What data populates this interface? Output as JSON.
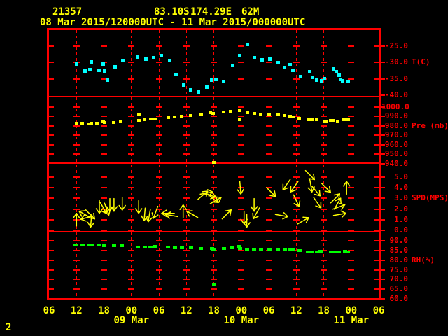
{
  "header": {
    "station_id": "21357",
    "latitude": "83.10S",
    "longitude": "174.29E",
    "elevation": "62M",
    "period": "08 Mar 2015/120000UTC - 11 Mar 2015/000000UTC"
  },
  "page_number": "2",
  "colors": {
    "background": "#000000",
    "frame": "#ff0000",
    "axis_labels": "#ff0000",
    "time_labels": "#ffff00",
    "temperature": "#00ffff",
    "pressure": "#ffff00",
    "wind": "#ffff00",
    "relative_humidity": "#00ff00"
  },
  "x_axis": {
    "start": "08 Mar 2015 06UTC",
    "end": "11 Mar 2015 06UTC",
    "hours_span": 72,
    "hour_tick_interval": 6,
    "hour_labels": [
      "06",
      "12",
      "18",
      "00",
      "06",
      "12",
      "18",
      "00",
      "06",
      "12",
      "18",
      "00",
      "06"
    ],
    "date_labels": [
      {
        "label": "09 Mar",
        "hour": 18
      },
      {
        "label": "10 Mar",
        "hour": 42
      },
      {
        "label": "11 Mar",
        "hour": 66
      }
    ]
  },
  "chart_data": [
    {
      "name": "temperature",
      "type": "scatter",
      "unit_label": "T(C)",
      "unit_label_value": -30,
      "color": "#00ffff",
      "ylim": [
        -40.43,
        -19.86
      ],
      "tick_values": [
        -25,
        -30,
        -35,
        -40
      ],
      "tick_labels": [
        "-25.0",
        "-30.0",
        "-35.0",
        "-40.0"
      ],
      "plus_rows": [
        -25,
        -30,
        -35
      ],
      "points": [
        [
          6.0,
          -30.4
        ],
        [
          7.8,
          -32.7
        ],
        [
          8.9,
          -32.1
        ],
        [
          9.3,
          -29.9
        ],
        [
          10.9,
          -32.5
        ],
        [
          11.8,
          -30.4
        ],
        [
          12.2,
          -32.7
        ],
        [
          12.7,
          -35.5
        ],
        [
          14.4,
          -31.4
        ],
        [
          16.1,
          -29.5
        ],
        [
          19.4,
          -28.4
        ],
        [
          21.1,
          -28.9
        ],
        [
          22.9,
          -28.6
        ],
        [
          24.6,
          -27.8
        ],
        [
          26.3,
          -29.3
        ],
        [
          27.7,
          -33.6
        ],
        [
          29.5,
          -37.0
        ],
        [
          31.0,
          -38.3
        ],
        [
          32.7,
          -39.1
        ],
        [
          34.5,
          -37.6
        ],
        [
          35.6,
          -35.5
        ],
        [
          36.4,
          -35.1
        ],
        [
          38.2,
          -35.9
        ],
        [
          40.1,
          -30.8
        ],
        [
          41.6,
          -27.8
        ],
        [
          43.3,
          -24.4
        ],
        [
          44.9,
          -28.6
        ],
        [
          46.5,
          -29.1
        ],
        [
          48.3,
          -28.9
        ],
        [
          50.0,
          -30.1
        ],
        [
          51.5,
          -31.6
        ],
        [
          52.6,
          -30.6
        ],
        [
          53.2,
          -32.3
        ],
        [
          55.0,
          -34.4
        ],
        [
          57.0,
          -32.9
        ],
        [
          57.6,
          -34.6
        ],
        [
          58.5,
          -35.5
        ],
        [
          59.5,
          -35.7
        ],
        [
          60.2,
          -34.9
        ],
        [
          62.1,
          -31.9
        ],
        [
          62.7,
          -32.9
        ],
        [
          63.3,
          -34.0
        ],
        [
          63.7,
          -35.1
        ],
        [
          64.2,
          -35.7
        ],
        [
          65.3,
          -35.9
        ]
      ]
    },
    {
      "name": "pressure",
      "type": "scatter",
      "unit_label": "Pre (mb)",
      "unit_label_value": 980,
      "color": "#ffff00",
      "ylim": [
        940.7,
        1011.1
      ],
      "tick_values": [
        1000,
        990,
        980,
        970,
        960,
        950,
        940
      ],
      "tick_labels": [
        "1000.0",
        "990.0",
        "980.0",
        "970.0",
        "960.0",
        "950.0",
        "940.0"
      ],
      "plus_rows": [
        1000,
        990,
        980,
        970,
        960,
        950
      ],
      "points": [
        [
          6.0,
          983.0
        ],
        [
          7.3,
          983.0
        ],
        [
          8.7,
          982.2
        ],
        [
          9.2,
          983.0
        ],
        [
          10.5,
          983.0
        ],
        [
          11.8,
          984.4
        ],
        [
          12.1,
          983.7
        ],
        [
          14.2,
          983.7
        ],
        [
          15.7,
          985.2
        ],
        [
          19.6,
          992.6
        ],
        [
          19.6,
          985.9
        ],
        [
          20.9,
          986.7
        ],
        [
          22.2,
          987.4
        ],
        [
          23.2,
          987.4
        ],
        [
          26.0,
          988.9
        ],
        [
          27.5,
          989.6
        ],
        [
          29.0,
          990.4
        ],
        [
          31.0,
          991.1
        ],
        [
          33.2,
          992.6
        ],
        [
          35.2,
          994.1
        ],
        [
          35.9,
          993.3
        ],
        [
          36.0,
          941.5
        ],
        [
          38.2,
          994.8
        ],
        [
          39.7,
          995.6
        ],
        [
          41.6,
          996.3
        ],
        [
          41.7,
          986.7
        ],
        [
          43.3,
          994.1
        ],
        [
          44.8,
          993.3
        ],
        [
          46.3,
          991.9
        ],
        [
          48.1,
          992.6
        ],
        [
          50.0,
          992.6
        ],
        [
          51.5,
          991.1
        ],
        [
          52.7,
          990.4
        ],
        [
          53.2,
          989.6
        ],
        [
          54.7,
          988.1
        ],
        [
          56.6,
          986.7
        ],
        [
          57.0,
          986.7
        ],
        [
          57.6,
          986.7
        ],
        [
          58.5,
          986.7
        ],
        [
          60.1,
          985.2
        ],
        [
          60.5,
          984.4
        ],
        [
          61.6,
          985.9
        ],
        [
          62.2,
          985.9
        ],
        [
          63.1,
          985.2
        ],
        [
          64.5,
          986.7
        ],
        [
          65.3,
          986.7
        ]
      ]
    },
    {
      "name": "wind",
      "type": "wind-arrows",
      "unit_label": "SPD(MPS)",
      "unit_label_value": 3,
      "color": "#ffff00",
      "ylim": [
        -0.13,
        6.32
      ],
      "tick_values": [
        5,
        4,
        3,
        2,
        1,
        0
      ],
      "tick_labels": [
        "5.0",
        "4.0",
        "3.0",
        "2.0",
        "1.0",
        "0.0"
      ],
      "plus_rows": [
        5,
        4,
        3,
        2,
        1,
        0
      ],
      "points": [
        [
          6.0,
          1.0,
          0
        ],
        [
          7.8,
          1.5,
          300
        ],
        [
          8.3,
          1.2,
          255
        ],
        [
          9.0,
          1.5,
          135
        ],
        [
          9.2,
          0.9,
          185
        ],
        [
          11.0,
          2.2,
          180
        ],
        [
          11.9,
          2.1,
          150
        ],
        [
          12.6,
          2.0,
          160
        ],
        [
          13.3,
          2.4,
          180
        ],
        [
          14.2,
          2.4,
          180
        ],
        [
          16.0,
          2.5,
          180
        ],
        [
          19.6,
          2.2,
          180
        ],
        [
          20.9,
          1.5,
          185
        ],
        [
          21.9,
          1.4,
          190
        ],
        [
          23.3,
          1.7,
          200
        ],
        [
          26.0,
          1.6,
          270
        ],
        [
          26.8,
          1.4,
          280
        ],
        [
          29.3,
          1.8,
          0
        ],
        [
          31.3,
          1.5,
          300
        ],
        [
          33.6,
          3.3,
          50
        ],
        [
          34.4,
          3.5,
          80
        ],
        [
          35.1,
          3.3,
          105
        ],
        [
          35.8,
          3.0,
          130
        ],
        [
          36.4,
          2.8,
          60
        ],
        [
          38.8,
          1.5,
          45
        ],
        [
          41.8,
          4.0,
          175
        ],
        [
          42.6,
          1.2,
          180
        ],
        [
          43.2,
          0.9,
          180
        ],
        [
          44.8,
          2.4,
          180
        ],
        [
          45.3,
          1.6,
          210
        ],
        [
          48.5,
          3.6,
          135
        ],
        [
          50.8,
          1.4,
          100
        ],
        [
          51.9,
          4.3,
          215
        ],
        [
          53.6,
          4.1,
          215
        ],
        [
          54.0,
          2.8,
          155
        ],
        [
          55.5,
          0.9,
          60
        ],
        [
          57.0,
          5.2,
          135
        ],
        [
          57.2,
          4.2,
          170
        ],
        [
          58.3,
          3.7,
          140
        ],
        [
          58.6,
          2.6,
          145
        ],
        [
          60.5,
          4.0,
          135
        ],
        [
          62.5,
          3.0,
          45
        ],
        [
          63.0,
          2.5,
          30
        ],
        [
          63.3,
          2.2,
          70
        ],
        [
          63.5,
          1.5,
          80
        ],
        [
          65.0,
          4.0,
          0
        ]
      ]
    },
    {
      "name": "relative_humidity",
      "type": "scatter",
      "unit_label": "RH(%)",
      "unit_label_value": 80,
      "color": "#00ff00",
      "ylim": [
        60.0,
        94.7
      ],
      "tick_values": [
        90,
        85,
        80,
        75,
        70,
        65,
        60
      ],
      "tick_labels": [
        "90.0",
        "85.0",
        "80.0",
        "75.0",
        "70.0",
        "65.0",
        "60.0"
      ],
      "plus_rows": [
        90,
        85,
        80,
        75,
        70,
        65
      ],
      "points": [
        [
          5.8,
          87.8
        ],
        [
          7.3,
          87.8
        ],
        [
          8.7,
          87.8
        ],
        [
          9.5,
          87.8
        ],
        [
          10.8,
          87.8
        ],
        [
          12.1,
          87.4
        ],
        [
          14.2,
          87.4
        ],
        [
          15.9,
          87.4
        ],
        [
          19.4,
          86.7
        ],
        [
          21.0,
          86.7
        ],
        [
          22.2,
          86.7
        ],
        [
          23.3,
          87.1
        ],
        [
          26.0,
          86.7
        ],
        [
          27.5,
          86.4
        ],
        [
          29.0,
          86.4
        ],
        [
          31.0,
          86.4
        ],
        [
          33.2,
          86.0
        ],
        [
          35.6,
          86.0
        ],
        [
          35.9,
          85.6
        ],
        [
          36.0,
          67.2
        ],
        [
          38.2,
          86.0
        ],
        [
          40.1,
          86.4
        ],
        [
          41.6,
          87.1
        ],
        [
          41.8,
          86.0
        ],
        [
          43.3,
          85.6
        ],
        [
          44.8,
          85.6
        ],
        [
          46.3,
          85.6
        ],
        [
          48.2,
          85.6
        ],
        [
          50.0,
          85.6
        ],
        [
          51.5,
          85.6
        ],
        [
          52.7,
          85.3
        ],
        [
          53.3,
          85.6
        ],
        [
          54.7,
          84.9
        ],
        [
          56.6,
          84.2
        ],
        [
          57.3,
          84.2
        ],
        [
          58.5,
          84.2
        ],
        [
          59.3,
          84.6
        ],
        [
          61.6,
          84.2
        ],
        [
          62.5,
          84.2
        ],
        [
          63.3,
          84.2
        ],
        [
          64.7,
          84.6
        ],
        [
          65.3,
          84.2
        ]
      ]
    }
  ]
}
